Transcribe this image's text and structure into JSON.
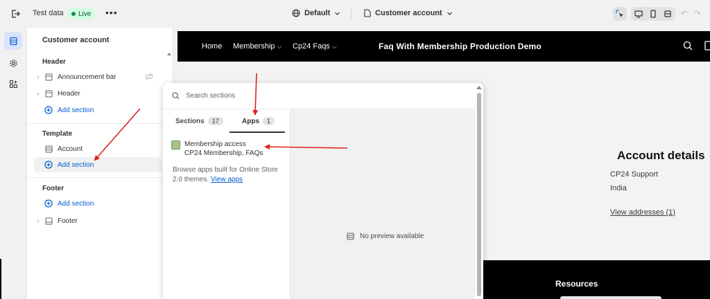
{
  "topbar": {
    "store_name": "Test data",
    "live_badge": "Live",
    "more": "•••",
    "theme": "Default",
    "page": "Customer account"
  },
  "sidebar": {
    "title": "Customer account",
    "header_group": {
      "heading": "Header",
      "items": [
        {
          "label": "Announcement bar"
        },
        {
          "label": "Header"
        }
      ],
      "add_label": "Add section"
    },
    "template_group": {
      "heading": "Template",
      "items": [
        {
          "label": "Account"
        }
      ],
      "add_label": "Add section"
    },
    "footer_group": {
      "heading": "Footer",
      "add_label": "Add section",
      "items": [
        {
          "label": "Footer"
        }
      ]
    }
  },
  "storefront": {
    "nav": [
      "Home",
      "Membership",
      "Cp24 Faqs"
    ],
    "brand": "Faq With Membership Production Demo",
    "account_title": "Account details",
    "account_name": "CP24 Support",
    "account_country": "India",
    "view_addresses": "View addresses (1)",
    "footer_heading": "Resources"
  },
  "popover": {
    "search_placeholder": "Search sections",
    "tabs": [
      {
        "label": "Sections",
        "count": "17"
      },
      {
        "label": "Apps",
        "count": "1"
      }
    ],
    "app": {
      "name": "Membership access",
      "subtitle": "CP24 Membership, FAQs"
    },
    "browse_text": "Browse apps built for Online Store 2.0 themes.",
    "browse_link": "View apps",
    "no_preview": "No preview available"
  },
  "colors": {
    "accent": "#005bd3",
    "annotation_arrow": "#e01e1e",
    "live_badge_bg": "#cdfee1"
  }
}
